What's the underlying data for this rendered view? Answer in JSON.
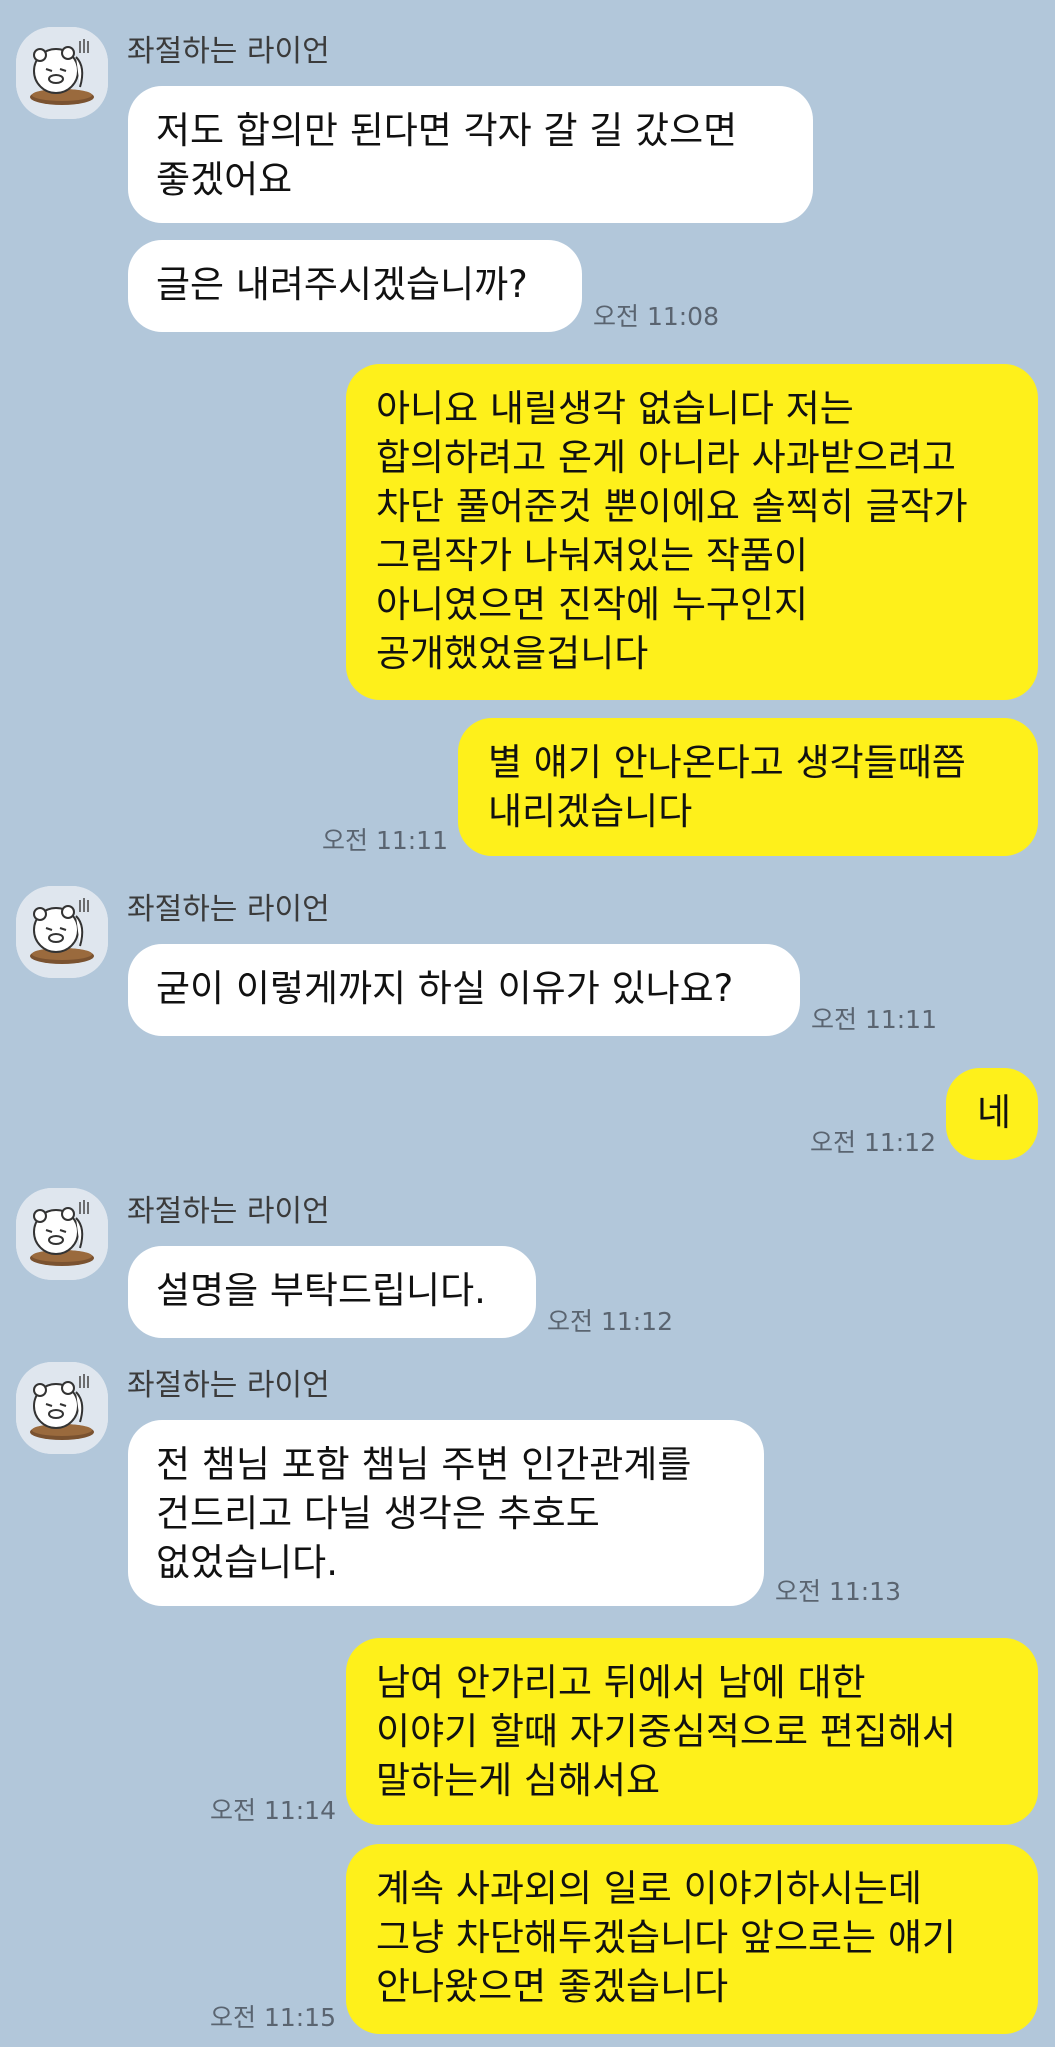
{
  "conversation": {
    "messages": [
      {
        "id": "m1",
        "direction": "incoming",
        "sender": "좌절하는 라이언",
        "lines": [
          "저도 합의만 된다면 각자 갈 길 갔으면",
          "좋겠어요"
        ]
      },
      {
        "id": "m2",
        "direction": "incoming",
        "lines": [
          "글은 내려주시겠습니까?"
        ],
        "time": "오전 11:08"
      },
      {
        "id": "m3",
        "direction": "outgoing",
        "lines": [
          "아니요 내릴생각 없습니다 저는",
          "합의하려고 온게 아니라 사과받으려고",
          "차단 풀어준것 뿐이에요 솔찍히 글작가",
          "그림작가 나눠져있는 작품이",
          "아니였으면 진작에 누구인지",
          "공개했었을겁니다"
        ]
      },
      {
        "id": "m4",
        "direction": "outgoing",
        "lines": [
          "별 얘기 안나온다고 생각들때쯤",
          "내리겠습니다"
        ],
        "time": "오전 11:11"
      },
      {
        "id": "m5",
        "direction": "incoming",
        "sender": "좌절하는 라이언",
        "lines": [
          "굳이 이렇게까지 하실 이유가 있나요?"
        ],
        "time": "오전 11:11"
      },
      {
        "id": "m6",
        "direction": "outgoing",
        "lines": [
          "네"
        ],
        "time": "오전 11:12"
      },
      {
        "id": "m7",
        "direction": "incoming",
        "sender": "좌절하는 라이언",
        "lines": [
          "설명을 부탁드립니다."
        ],
        "time": "오전 11:12"
      },
      {
        "id": "m8",
        "direction": "incoming",
        "sender": "좌절하는 라이언",
        "lines": [
          "전 챔님 포함 챔님 주변 인간관계를",
          "건드리고 다닐 생각은 추호도",
          "없었습니다."
        ],
        "time": "오전 11:13"
      },
      {
        "id": "m9",
        "direction": "outgoing",
        "lines": [
          "남여 안가리고 뒤에서 남에 대한",
          "이야기 할때 자기중심적으로 편집해서",
          "말하는게 심해서요"
        ],
        "time": "오전 11:14"
      },
      {
        "id": "m10",
        "direction": "outgoing",
        "lines": [
          "계속 사과외의 일로 이야기하시는데",
          "그냥 차단해두겠습니다 앞으로는 얘기",
          "안나왔으면 좋겠습니다"
        ],
        "time": "오전 11:15"
      }
    ]
  },
  "colors": {
    "background": "#b2c7da",
    "incoming_bubble": "#ffffff",
    "outgoing_bubble": "#fef01b",
    "timestamp": "#5a6470"
  },
  "icons": {
    "avatar": "ryan-character-avatar-icon"
  }
}
